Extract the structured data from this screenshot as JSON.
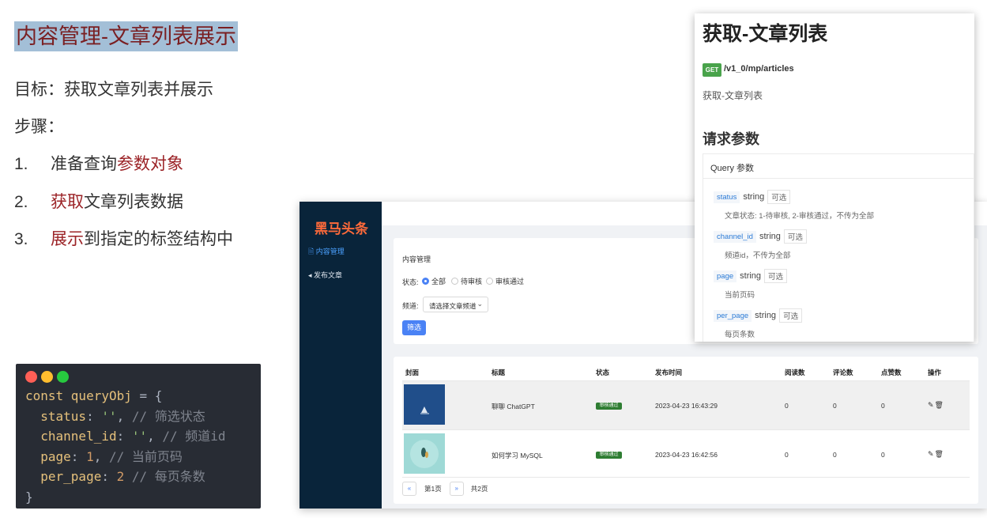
{
  "slide": {
    "title": "内容管理-文章列表展示",
    "goal": "目标：获取文章列表并展示",
    "steps_label": "步骤：",
    "steps": [
      {
        "num": "1.",
        "pre": "准备查询",
        "hl": "参数对象",
        "post": ""
      },
      {
        "num": "2.",
        "pre": "",
        "hl": "获取",
        "post": "文章列表数据"
      },
      {
        "num": "3.",
        "pre": "",
        "hl": "展示",
        "post": "到指定的标签结构中"
      }
    ],
    "accent_color": "#9b2226"
  },
  "code": {
    "window_dots": [
      "#ff5f56",
      "#ffbd2e",
      "#27c93f"
    ],
    "lines": [
      {
        "kw": "const ",
        "var": "queryObj",
        "pun": " = {",
        "str": "",
        "num": "",
        "cmt": ""
      },
      {
        "prop": "  status",
        "pun": ": ",
        "str": "''",
        "after": ", ",
        "cmt": "// 筛选状态"
      },
      {
        "prop": "  channel_id",
        "pun": ": ",
        "str": "''",
        "after": ", ",
        "cmt": "// 频道id"
      },
      {
        "prop": "  page",
        "pun": ": ",
        "num": "1",
        "after": ", ",
        "cmt": "// 当前页码"
      },
      {
        "prop": "  per_page",
        "pun": ": ",
        "num": "2",
        "after": " ",
        "cmt": "// 每页条数"
      },
      {
        "pun": "}"
      }
    ]
  },
  "app": {
    "brand": "黑马头条",
    "menu": [
      {
        "icon": "document-icon",
        "glyph": "🗎",
        "label": "内容管理"
      },
      {
        "icon": "send-icon",
        "glyph": "◂",
        "label": "发布文章"
      }
    ],
    "filter": {
      "breadcrumb": "内容管理",
      "status_label": "状态:",
      "status_options": [
        "全部",
        "待审核",
        "审核通过"
      ],
      "channel_label": "频道:",
      "channel_placeholder": "请选择文章频道",
      "submit_label": "筛选"
    },
    "table": {
      "columns": [
        "封面",
        "标题",
        "状态",
        "发布时间",
        "阅读数",
        "评论数",
        "点赞数",
        "操作"
      ],
      "rows": [
        {
          "title": "聊聊 ChatGPT",
          "status": "审核通过",
          "time": "2023-04-23 16:43:29",
          "reads": "0",
          "comments": "0",
          "likes": "0"
        },
        {
          "title": "如何学习 MySQL",
          "status": "审核通过",
          "time": "2023-04-23 16:42:56",
          "reads": "0",
          "comments": "0",
          "likes": "0"
        }
      ],
      "pager": {
        "prev": "«",
        "page": "第1页",
        "next": "»",
        "total": "共2页"
      }
    }
  },
  "api": {
    "title": "获取-文章列表",
    "method": "GET",
    "path": "/v1_0/mp/articles",
    "desc": "获取-文章列表",
    "params_heading": "请求参数",
    "query_heading": "Query 参数",
    "params": [
      {
        "name": "status",
        "type": "string",
        "opt": "可选",
        "desc": "文章状态: 1-待审核, 2-审核通过，不传为全部"
      },
      {
        "name": "channel_id",
        "type": "string",
        "opt": "可选",
        "desc": "频道id，不传为全部"
      },
      {
        "name": "page",
        "type": "string",
        "opt": "可选",
        "desc": "当前页码"
      },
      {
        "name": "per_page",
        "type": "string",
        "opt": "可选",
        "desc": "每页条数"
      }
    ]
  }
}
